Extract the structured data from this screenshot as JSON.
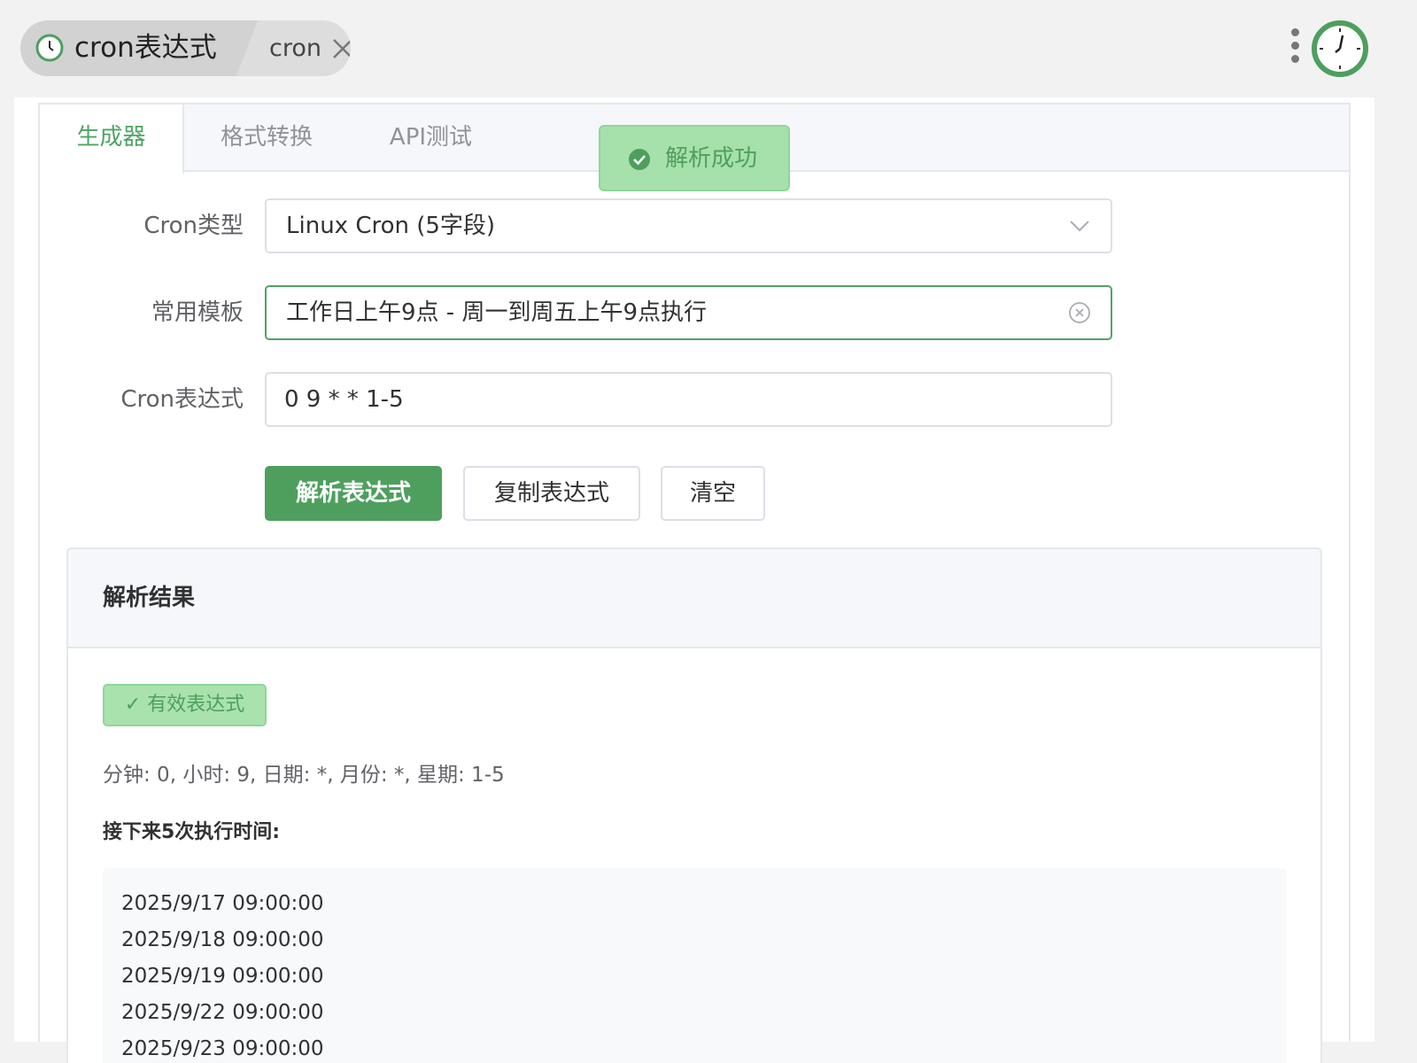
{
  "app": {
    "name": "cron表达式",
    "keyword": "cron",
    "logo_icon": "clock-icon",
    "accent": "#4e9f5e"
  },
  "tabs": [
    {
      "label": "生成器",
      "active": true
    },
    {
      "label": "格式转换",
      "active": false
    },
    {
      "label": "API测试",
      "active": false
    }
  ],
  "form": {
    "cron_type": {
      "label": "Cron类型",
      "value": "Linux Cron (5字段)"
    },
    "template": {
      "label": "常用模板",
      "value": "工作日上午9点 - 周一到周五上午9点执行"
    },
    "expression": {
      "label": "Cron表达式",
      "value": "0 9 * * 1-5"
    }
  },
  "buttons": {
    "parse": "解析表达式",
    "copy": "复制表达式",
    "clear": "清空"
  },
  "result": {
    "title": "解析结果",
    "valid_tag": "✓ 有效表达式",
    "fields_text": "分钟: 0, 小时: 9, 日期: *, 月份: *, 星期: 1-5",
    "next_title": "接下来5次执行时间:",
    "next_times": [
      "2025/9/17 09:00:00",
      "2025/9/18 09:00:00",
      "2025/9/19 09:00:00",
      "2025/9/22 09:00:00",
      "2025/9/23 09:00:00"
    ]
  },
  "toast": {
    "text": "解析成功",
    "icon": "check-circle-icon"
  }
}
